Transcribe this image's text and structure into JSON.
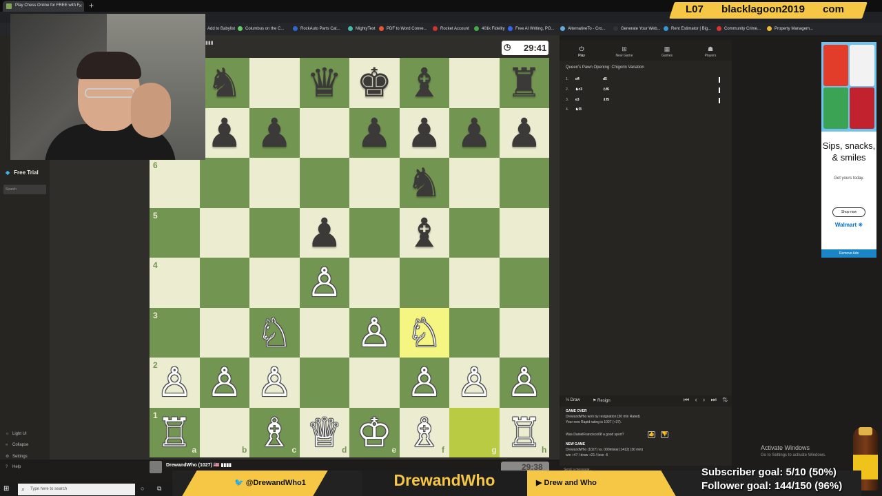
{
  "browser": {
    "tab_title": "Play Chess Online for FREE with F",
    "close": "×",
    "newtab": "+",
    "bookmarks": [
      {
        "label": "Add to Babylist",
        "color": "#e66"
      },
      {
        "label": "Columbus on the C...",
        "color": "#6c6"
      },
      {
        "label": "RockAuto Parts Cat...",
        "color": "#36c"
      },
      {
        "label": "MightyText",
        "color": "#4ba"
      },
      {
        "label": "PDF to Word Conve...",
        "color": "#e53"
      },
      {
        "label": "Rocket Account",
        "color": "#c33"
      },
      {
        "label": "401k Fidelity",
        "color": "#4a4"
      },
      {
        "label": "Free AI Writing, PO...",
        "color": "#36e"
      },
      {
        "label": "AlternativeTo - Cro...",
        "color": "#6ad"
      },
      {
        "label": "Generate Your Web...",
        "color": "#333"
      },
      {
        "label": "Rent Estimator | Big...",
        "color": "#39c"
      },
      {
        "label": "Community Crime...",
        "color": "#d33"
      },
      {
        "label": "Property Managem...",
        "color": "#eb3"
      }
    ]
  },
  "overlay": {
    "top_banner": [
      "L07",
      "blacklagoon2019",
      "com"
    ],
    "twitter": "@DrewandWho1",
    "channel": "DrewandWho",
    "youtube": "Drew and Who",
    "subscriber_goal": "Subscriber goal: 5/10 (50%)",
    "follower_goal": "Follower goal: 144/150 (96%)"
  },
  "sidebar": {
    "free_trial": "Free Trial",
    "search_placeholder": "Search",
    "links": [
      "Light UI",
      "Collapse",
      "Settings",
      "Help"
    ]
  },
  "game": {
    "top_clock": "29:41",
    "bottom_clock": "29:38",
    "bottom_player": "DrewandWho (1027) 🇺🇸 ▮▮▮▮",
    "top_player_flag": "▮▮▮",
    "files": [
      "a",
      "b",
      "c",
      "d",
      "e",
      "f",
      "g",
      "h"
    ],
    "ranks": [
      "6",
      "5",
      "4",
      "3",
      "2",
      "1"
    ],
    "pieces": [
      {
        "sq": "b8",
        "glyph": "♞",
        "color": "b"
      },
      {
        "sq": "d8",
        "glyph": "♛",
        "color": "b"
      },
      {
        "sq": "e8",
        "glyph": "♚",
        "color": "b"
      },
      {
        "sq": "f8",
        "glyph": "♝",
        "color": "b"
      },
      {
        "sq": "h8",
        "glyph": "♜",
        "color": "b"
      },
      {
        "sq": "b7",
        "glyph": "♟",
        "color": "b"
      },
      {
        "sq": "c7",
        "glyph": "♟",
        "color": "b"
      },
      {
        "sq": "e7",
        "glyph": "♟",
        "color": "b"
      },
      {
        "sq": "f7",
        "glyph": "♟",
        "color": "b"
      },
      {
        "sq": "g7",
        "glyph": "♟",
        "color": "b"
      },
      {
        "sq": "h7",
        "glyph": "♟",
        "color": "b"
      },
      {
        "sq": "f6",
        "glyph": "♞",
        "color": "b"
      },
      {
        "sq": "d5",
        "glyph": "♟",
        "color": "b"
      },
      {
        "sq": "f5",
        "glyph": "♝",
        "color": "b"
      },
      {
        "sq": "d4",
        "glyph": "♙",
        "color": "w"
      },
      {
        "sq": "c3",
        "glyph": "♘",
        "color": "w"
      },
      {
        "sq": "e3",
        "glyph": "♙",
        "color": "w"
      },
      {
        "sq": "f3",
        "glyph": "♘",
        "color": "w"
      },
      {
        "sq": "a2",
        "glyph": "♙",
        "color": "w"
      },
      {
        "sq": "b2",
        "glyph": "♙",
        "color": "w"
      },
      {
        "sq": "c2",
        "glyph": "♙",
        "color": "w"
      },
      {
        "sq": "f2",
        "glyph": "♙",
        "color": "w"
      },
      {
        "sq": "g2",
        "glyph": "♙",
        "color": "w"
      },
      {
        "sq": "h2",
        "glyph": "♙",
        "color": "w"
      },
      {
        "sq": "a1",
        "glyph": "♖",
        "color": "w"
      },
      {
        "sq": "c1",
        "glyph": "♗",
        "color": "w"
      },
      {
        "sq": "d1",
        "glyph": "♕",
        "color": "w"
      },
      {
        "sq": "e1",
        "glyph": "♔",
        "color": "w"
      },
      {
        "sq": "f1",
        "glyph": "♗",
        "color": "w"
      },
      {
        "sq": "h1",
        "glyph": "♖",
        "color": "w"
      }
    ],
    "highlight_from": "g1",
    "highlight_to": "f3",
    "colors": {
      "light": "#ebecd0",
      "dark": "#739552"
    }
  },
  "panel": {
    "tabs": [
      {
        "label": "Play",
        "icon": "⏻"
      },
      {
        "label": "New Game",
        "icon": "⊞"
      },
      {
        "label": "Games",
        "icon": "▦"
      },
      {
        "label": "Players",
        "icon": "☗"
      }
    ],
    "opening": "Queen's Pawn Opening: Chigorin Variation",
    "moves": [
      {
        "n": "1.",
        "w": "d4",
        "b": "d5"
      },
      {
        "n": "2.",
        "w": "♞c3",
        "b": "♘f6"
      },
      {
        "n": "3.",
        "w": "e3",
        "b": "♗f5"
      },
      {
        "n": "4.",
        "w": "♞f3",
        "b": ""
      }
    ],
    "draw": "Draw",
    "resign": "Resign",
    "nav": "⏮ ‹ › ⏭ ⇅",
    "game_over": "GAME OVER",
    "result": "DrewandWho won by resignation (30 min Rated)",
    "rating": "Your new Rapid rating is 1027 (+37).",
    "question": "Was DanielFrancisco08 a good sport?",
    "new_game": "NEW GAME",
    "new_game_line": "DrewandWho (1027) vs. 000intwai (1412) (30 min)",
    "odds": "win +47 / draw +21 / lose -5",
    "chat_placeholder": "Send a message..."
  },
  "ad": {
    "headline": "Sips, snacks, & smiles",
    "sub": "Get yours today.",
    "button": "Shop now",
    "brand": "Walmart ✳",
    "remove": "Remove Ads"
  },
  "windows": {
    "activate": "Activate Windows",
    "activate_sub": "Go to Settings to activate Windows.",
    "search": "Type here to search"
  }
}
